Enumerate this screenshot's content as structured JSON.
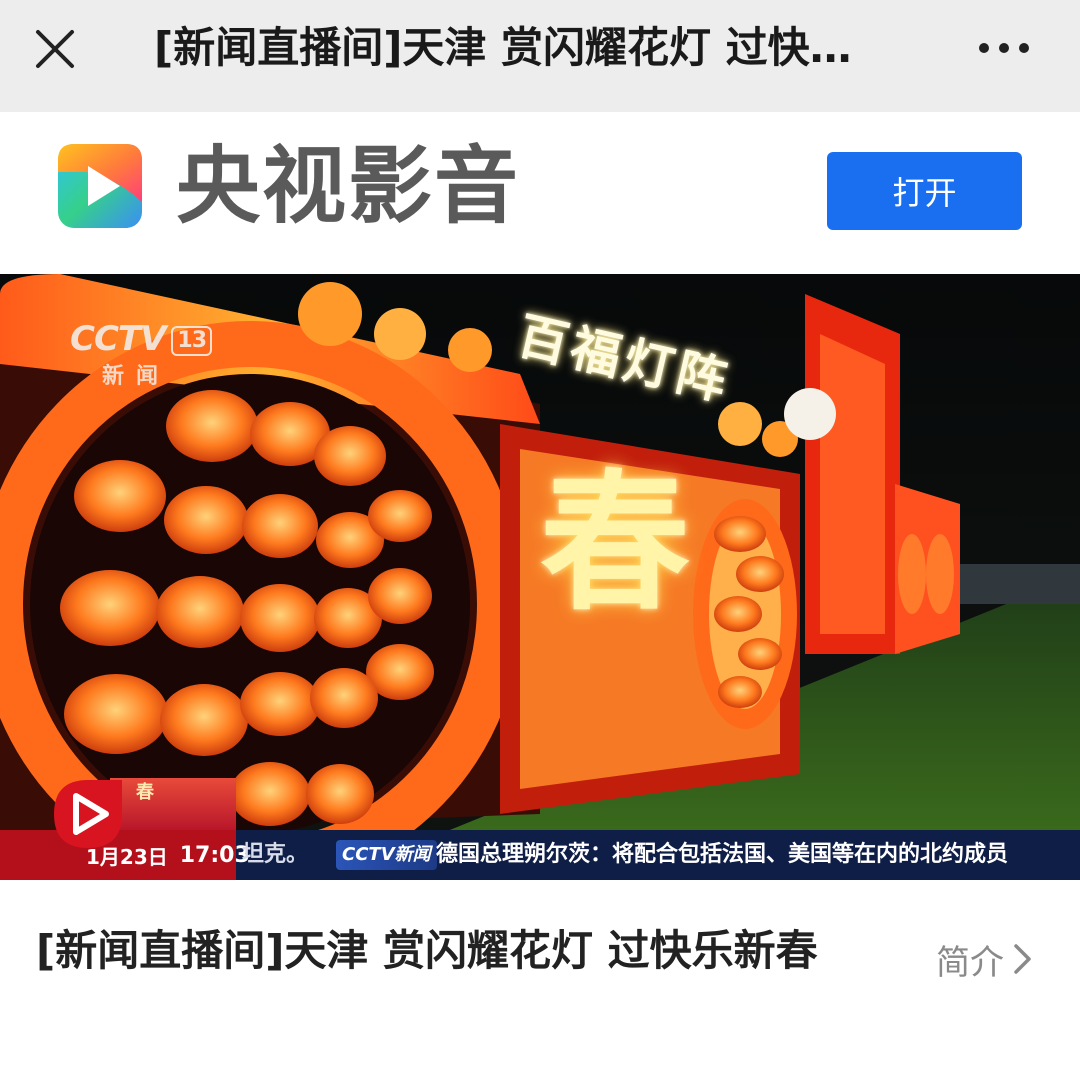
{
  "nav": {
    "title": "[新闻直播间]天津 赏闪耀花灯 过快…",
    "close_icon": "close-icon",
    "more_icon": "more-dots-icon"
  },
  "app_banner": {
    "app_name": "央视影音",
    "open_label": "打开",
    "logo_icon": "cctv-video-app-logo",
    "brand_color": "#1a6ff0"
  },
  "video": {
    "watermark": "CCTV",
    "channel_number": "13",
    "channel_name": "新闻",
    "sign_text": "百福灯阵",
    "lantern_char": "春",
    "ticker": {
      "date": "1月23日",
      "time": "17:03",
      "previous_fragment": "坦克。",
      "logo": "CCTV新闻",
      "headline": "德国总理朔尔茨：将配合包括法国、美国等在内的北约成员"
    },
    "promo_char": "春",
    "play_icon": "play-badge-icon"
  },
  "content": {
    "title": "[新闻直播间]天津 赏闪耀花灯 过快乐新春",
    "intro_label": "简介",
    "chevron_icon": "chevron-right-icon"
  }
}
